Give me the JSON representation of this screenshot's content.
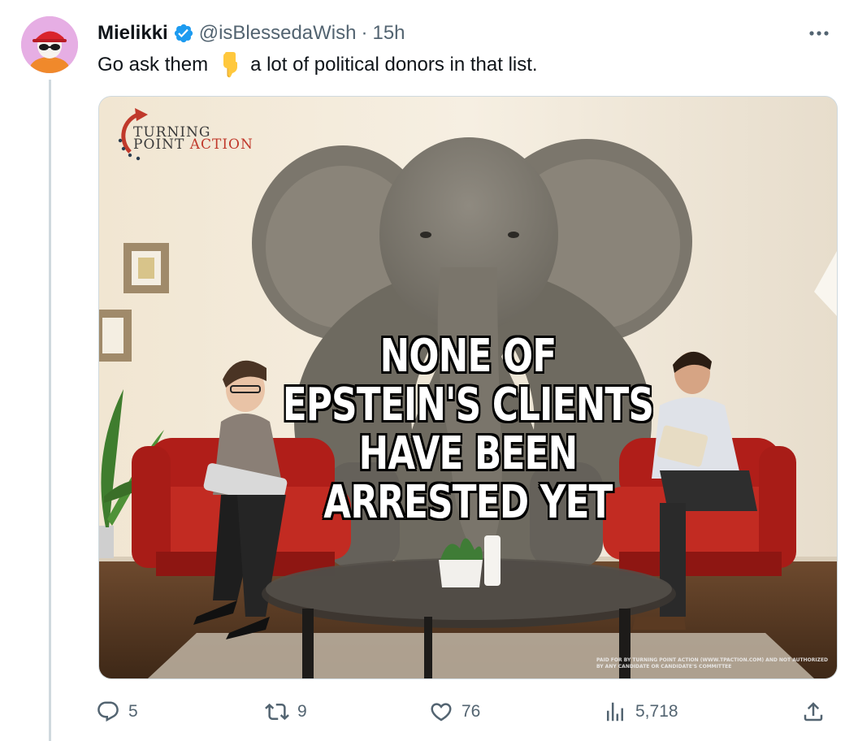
{
  "tweet": {
    "display_name": "Mielikki",
    "handle": "@isBlessedaWish",
    "separator": "·",
    "timestamp": "15h",
    "text_before_emoji": "Go ask them",
    "text_after_emoji": "a lot of political donors in that list.",
    "emoji_name": "backhand-index-pointing-down"
  },
  "media": {
    "caption_lines": [
      "NONE OF",
      "EPSTEIN'S CLIENTS",
      "HAVE BEEN",
      "ARRESTED YET"
    ],
    "logo_line1": "TURNING",
    "logo_line2": "POINT",
    "logo_line2_accent": "ACTION",
    "disclaimer": "PAID FOR BY TURNING POINT ACTION (WWW.TPACTION.COM) AND NOT AUTHORIZED BY ANY CANDIDATE OR CANDIDATE'S COMMITTEE"
  },
  "actions": {
    "reply_count": "5",
    "retweet_count": "9",
    "like_count": "76",
    "view_count": "5,718"
  },
  "colors": {
    "verified_blue": "#1d9bf0",
    "muted_text": "#536471",
    "accent_red": "#c0392b"
  },
  "icons": [
    "verified-badge-icon",
    "more-options-icon",
    "reply-icon",
    "retweet-icon",
    "like-icon",
    "views-icon",
    "share-icon"
  ]
}
